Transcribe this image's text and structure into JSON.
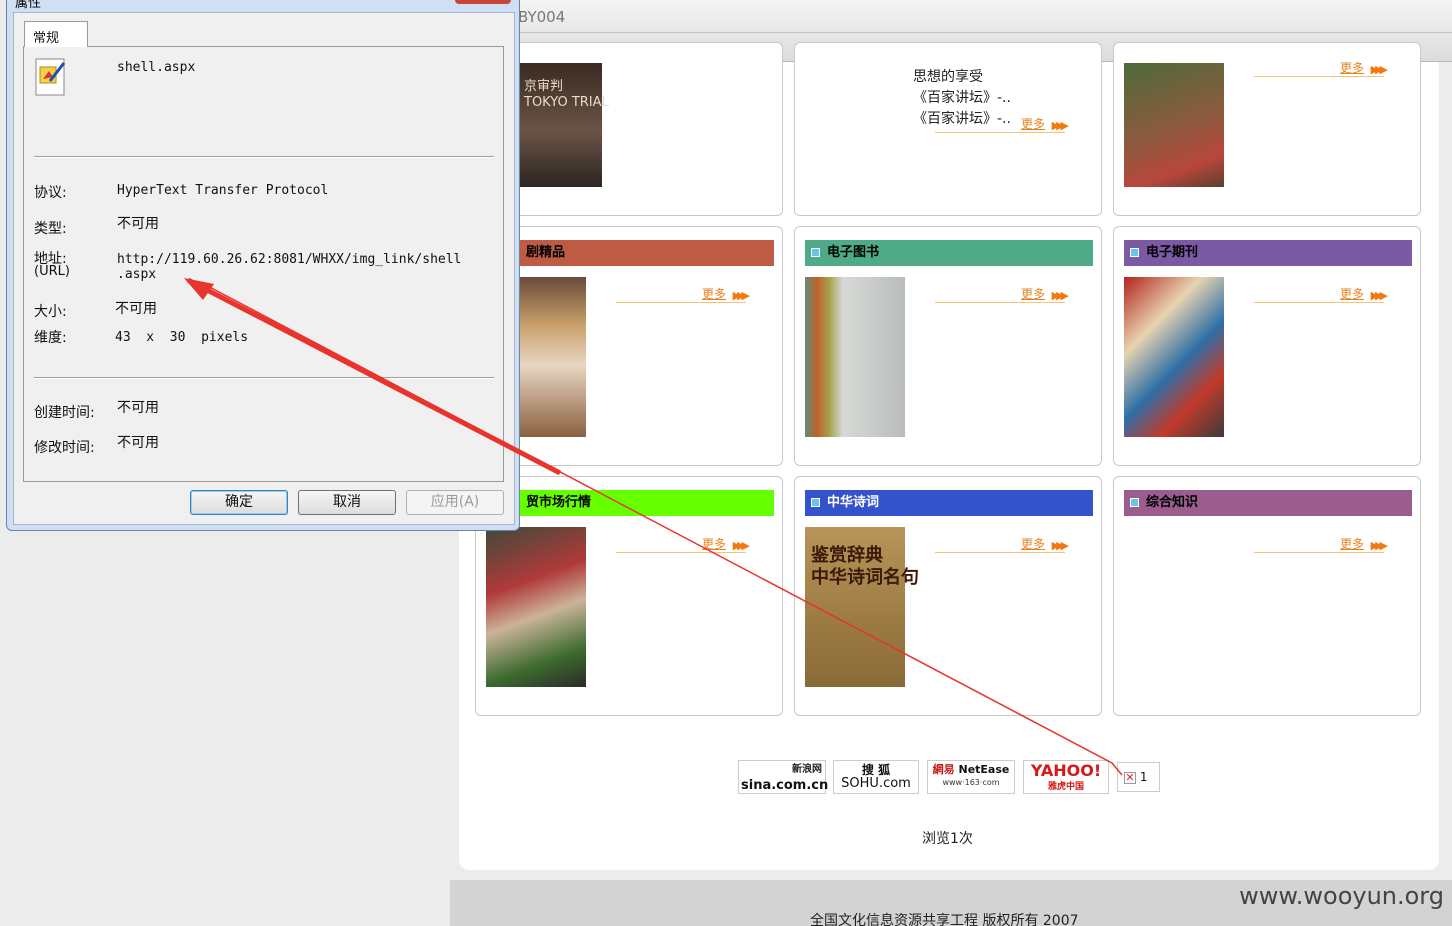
{
  "browser": {
    "tab_title": "BY004"
  },
  "cards": [
    {
      "header": "",
      "header_color": "",
      "thumb": "film-poster",
      "thumb_text": "京审判\nTOKYO TRIAL",
      "more": "更多",
      "lines": []
    },
    {
      "header": "",
      "header_color": "",
      "thumb": "",
      "thumb_text": "",
      "more": "更多",
      "lines": [
        "思想的享受",
        "《百家讲坛》-..",
        "《百家讲坛》-.."
      ]
    },
    {
      "header": "",
      "header_color": "",
      "thumb": "orchard-photo",
      "thumb_text": "",
      "more": "更多",
      "lines": []
    },
    {
      "header": "剧精品",
      "header_color": "#bd5b45",
      "thumb": "opera-photo",
      "thumb_text": "",
      "more": "更多",
      "lines": []
    },
    {
      "header": "电子图书",
      "header_color": "#4fab87",
      "thumb": "book-box",
      "thumb_text": "",
      "more": "更多",
      "lines": []
    },
    {
      "header": "电子期刊",
      "header_color": "#7a5aa2",
      "thumb": "magazines",
      "thumb_text": "",
      "more": "更多",
      "lines": []
    },
    {
      "header": "贸市场行情",
      "header_color": "#66ff00",
      "thumb": "market-photo",
      "thumb_text": "",
      "more": "更多",
      "lines": []
    },
    {
      "header": "中华诗词",
      "header_color": "#3352cc",
      "thumb": "poetry-book",
      "thumb_text": "鉴赏辞典\n中华诗词名句",
      "more": "更多",
      "lines": []
    },
    {
      "header": "综合知识",
      "header_color": "#9a5d8e",
      "thumb": "",
      "thumb_text": "",
      "more": "更多",
      "lines": []
    }
  ],
  "logos": {
    "sina": "sina.com.cn",
    "sina_cn": "新浪网",
    "sohu_top": "搜 狐",
    "sohu": "SOHU.com",
    "netease_cn": "網易",
    "netease": "NetEase",
    "netease_url": "www·163·com",
    "yahoo": "YAHOO!",
    "yahoo_cn": "雅虎中国",
    "broken_img_number": "1"
  },
  "views_text": "浏览1次",
  "footer": {
    "copyright": "全国文化信息资源共享工程   版权所有  2007",
    "watermark": "www.wooyun.org"
  },
  "dialog": {
    "title": "属性",
    "tab": "常规",
    "filename": "shell.aspx",
    "protocol_label": "协议:",
    "protocol_value": "HyperText Transfer Protocol",
    "type_label": "类型:",
    "type_value": "不可用",
    "address_label": "地址:",
    "address_label_sub": "(URL)",
    "address_value_1": "http://119.60.26.62:8081/WHXX/img_link/shell",
    "address_value_2": ".aspx",
    "size_label": "大小:",
    "size_value": "不可用",
    "dimensions_label": "维度:",
    "dimensions_value": "43  x  30  pixels",
    "created_label": "创建时间:",
    "created_value": "不可用",
    "modified_label": "修改时间:",
    "modified_value": "不可用",
    "ok_button": "确定",
    "cancel_button": "取消",
    "apply_button": "应用(A)"
  },
  "colors": {
    "arrow": "#e8342c",
    "more_link": "#e8821f"
  }
}
